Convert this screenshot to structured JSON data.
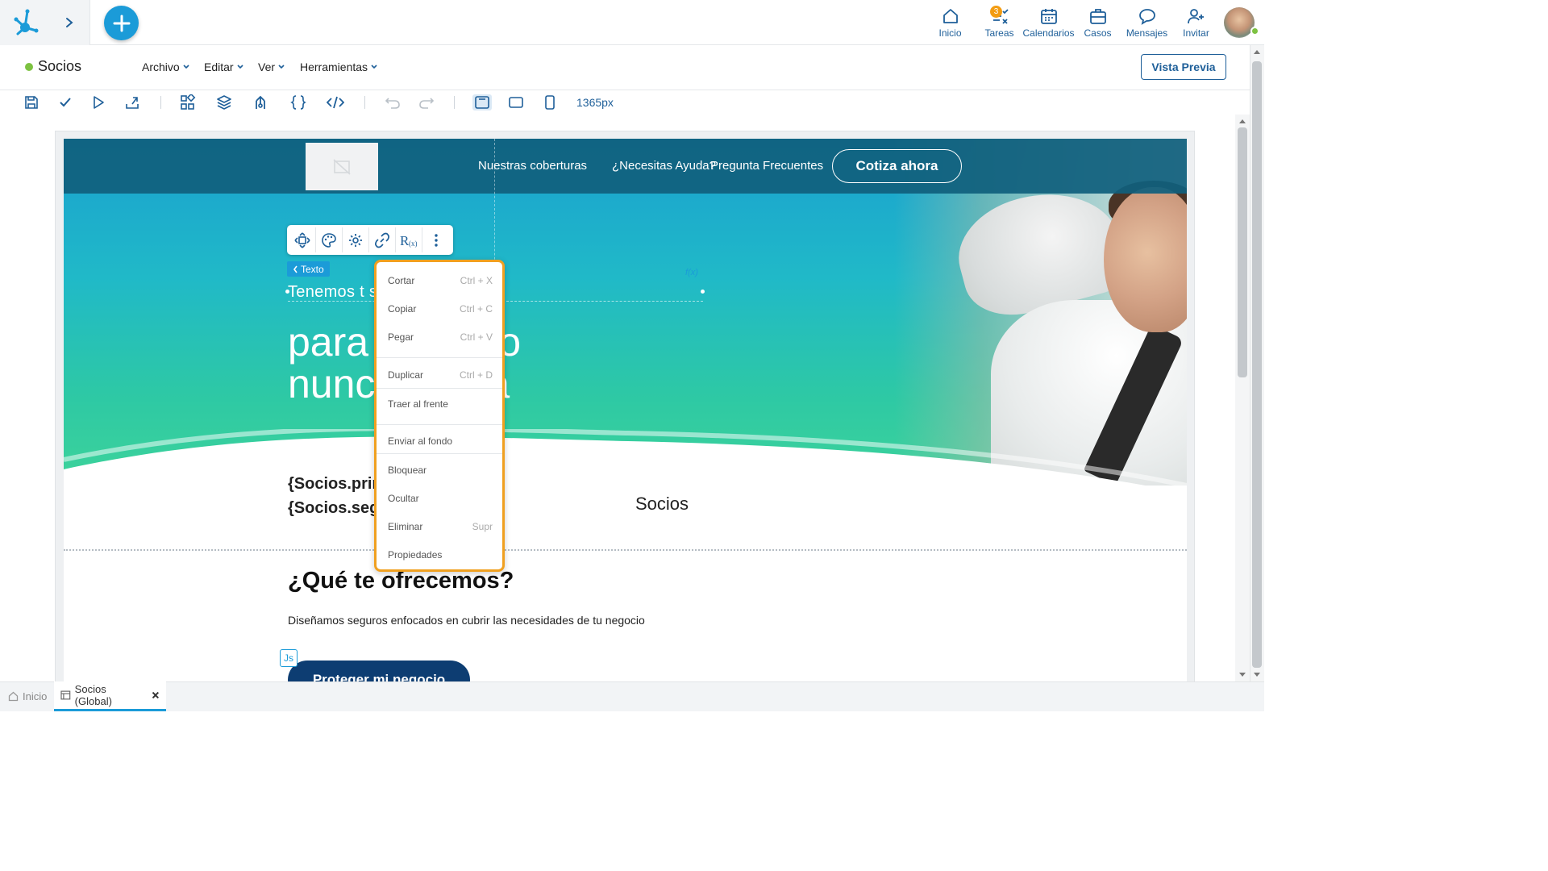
{
  "topnav": {
    "items": [
      {
        "label": "Inicio",
        "icon": "home-icon"
      },
      {
        "label": "Tareas",
        "icon": "tasks-icon",
        "badge": "3"
      },
      {
        "label": "Calendarios",
        "icon": "calendar-icon"
      },
      {
        "label": "Casos",
        "icon": "briefcase-icon"
      },
      {
        "label": "Mensajes",
        "icon": "chat-icon"
      },
      {
        "label": "Invitar",
        "icon": "invite-user-icon"
      }
    ]
  },
  "document": {
    "title": "Socios",
    "menus": [
      "Archivo",
      "Editar",
      "Ver",
      "Herramientas"
    ],
    "preview_label": "Vista Previa"
  },
  "toolbar": {
    "width_label": "1365px"
  },
  "site": {
    "nav": [
      "Nuestras coberturas",
      "¿Necesitas Ayuda?",
      "Pregunta Frecuentes"
    ],
    "cta_label": "Cotiza ahora",
    "hero_sub": "Tenemos t          sitas",
    "hero_title_1": "para          negocio",
    "hero_title_2": "nunc          etenga",
    "fx_tag": "f(x)",
    "bind_1": "{Socios.prir",
    "bind_2": "{Socios.seg",
    "socios_label": "Socios",
    "offer_title": "¿Qué te ofrecemos?",
    "offer_text": "Diseñamos seguros enfocados en cubrir las necesidades de tu negocio",
    "js_tag": "Js",
    "protect_label": "Proteger mi negocio"
  },
  "element_toolbar": {
    "chip_label": "Texto"
  },
  "context_menu": {
    "items": [
      {
        "label": "Cortar",
        "shortcut": "Ctrl + X"
      },
      {
        "label": "Copiar",
        "shortcut": "Ctrl + C"
      },
      {
        "label": "Pegar",
        "shortcut": "Ctrl + V"
      },
      {
        "label": "Duplicar",
        "shortcut": "Ctrl + D"
      },
      {
        "label": "Traer al frente",
        "shortcut": ""
      },
      {
        "label": "Enviar al fondo",
        "shortcut": ""
      },
      {
        "label": "Bloquear",
        "shortcut": ""
      },
      {
        "label": "Ocultar",
        "shortcut": ""
      },
      {
        "label": "Eliminar",
        "shortcut": "Supr"
      },
      {
        "label": "Propiedades",
        "shortcut": ""
      }
    ]
  },
  "bottom_tabs": [
    {
      "label": "Inicio"
    },
    {
      "label": "Socios (Global)"
    }
  ],
  "colors": {
    "accent": "#1b9bd8",
    "brand_dark": "#1e5f99",
    "context_border": "#f0a020",
    "hero_header": "#10607d"
  }
}
